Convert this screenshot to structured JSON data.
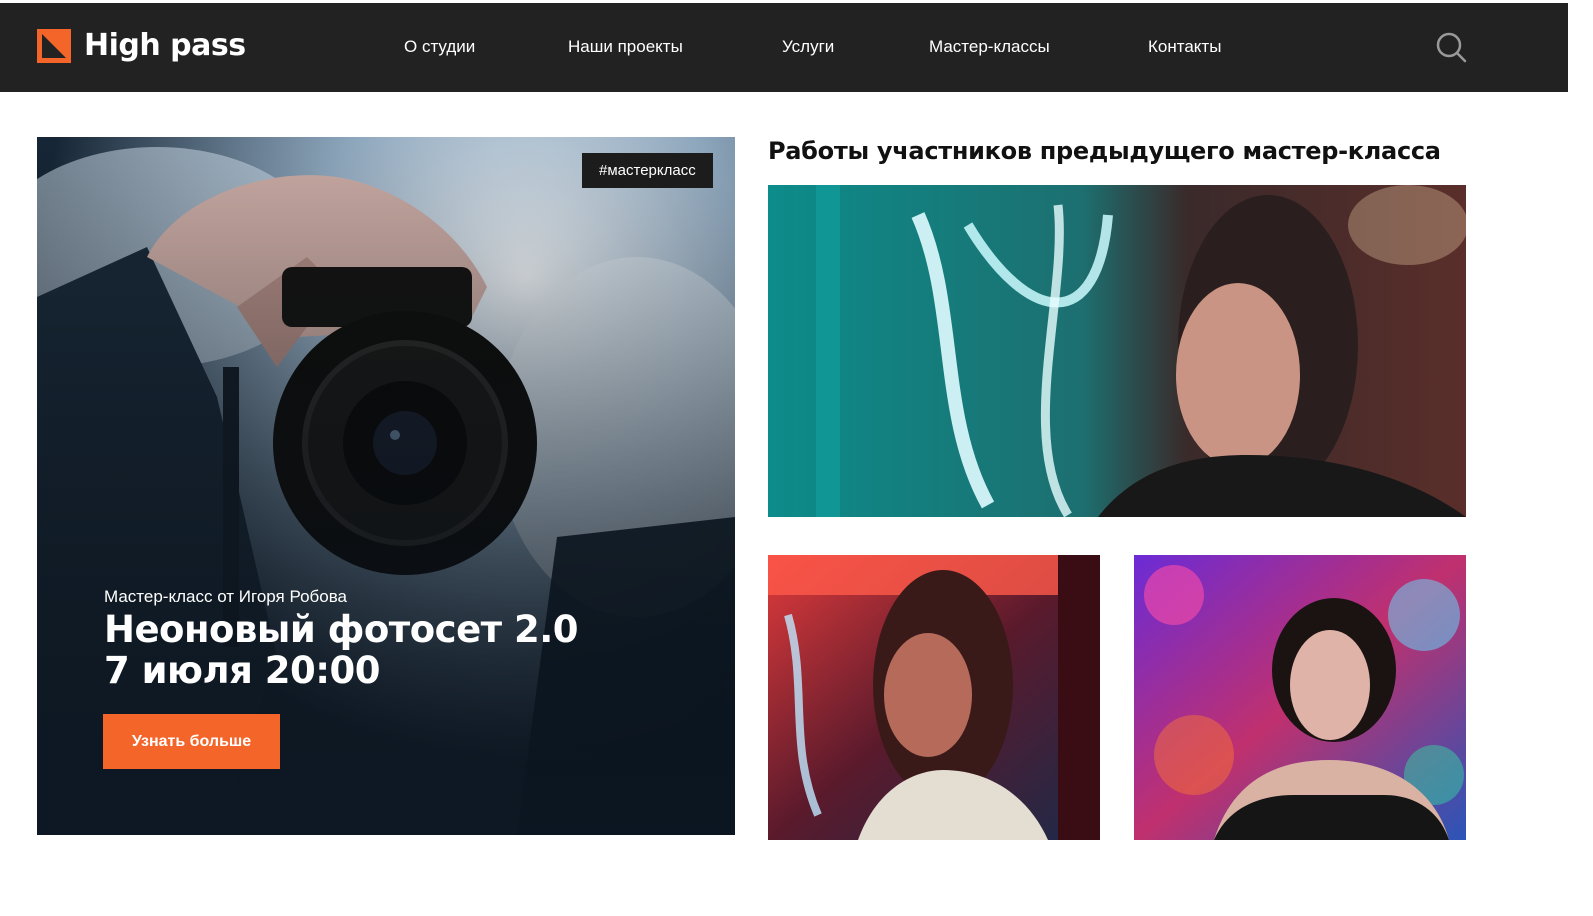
{
  "header": {
    "logo_text": "High pass",
    "logo_icon": "logo-mark-icon",
    "search_icon": "search-icon",
    "nav": [
      {
        "label": "О студии"
      },
      {
        "label": "Наши проекты"
      },
      {
        "label": "Услуги"
      },
      {
        "label": "Мастер-классы"
      },
      {
        "label": "Контакты"
      }
    ]
  },
  "hero": {
    "tag": "#мастеркласс",
    "subtitle": "Мастер-класс от Игоря Робова",
    "title_line1": "Неоновый фотосет 2.0",
    "title_line2": "7 июля 20:00",
    "button_label": "Узнать больше"
  },
  "gallery": {
    "title": "Работы участников предыдущего мастер-класса"
  },
  "colors": {
    "accent": "#f4652a",
    "header_bg": "#222222",
    "tag_bg": "#1c1c1c",
    "text_dark": "#111111"
  }
}
